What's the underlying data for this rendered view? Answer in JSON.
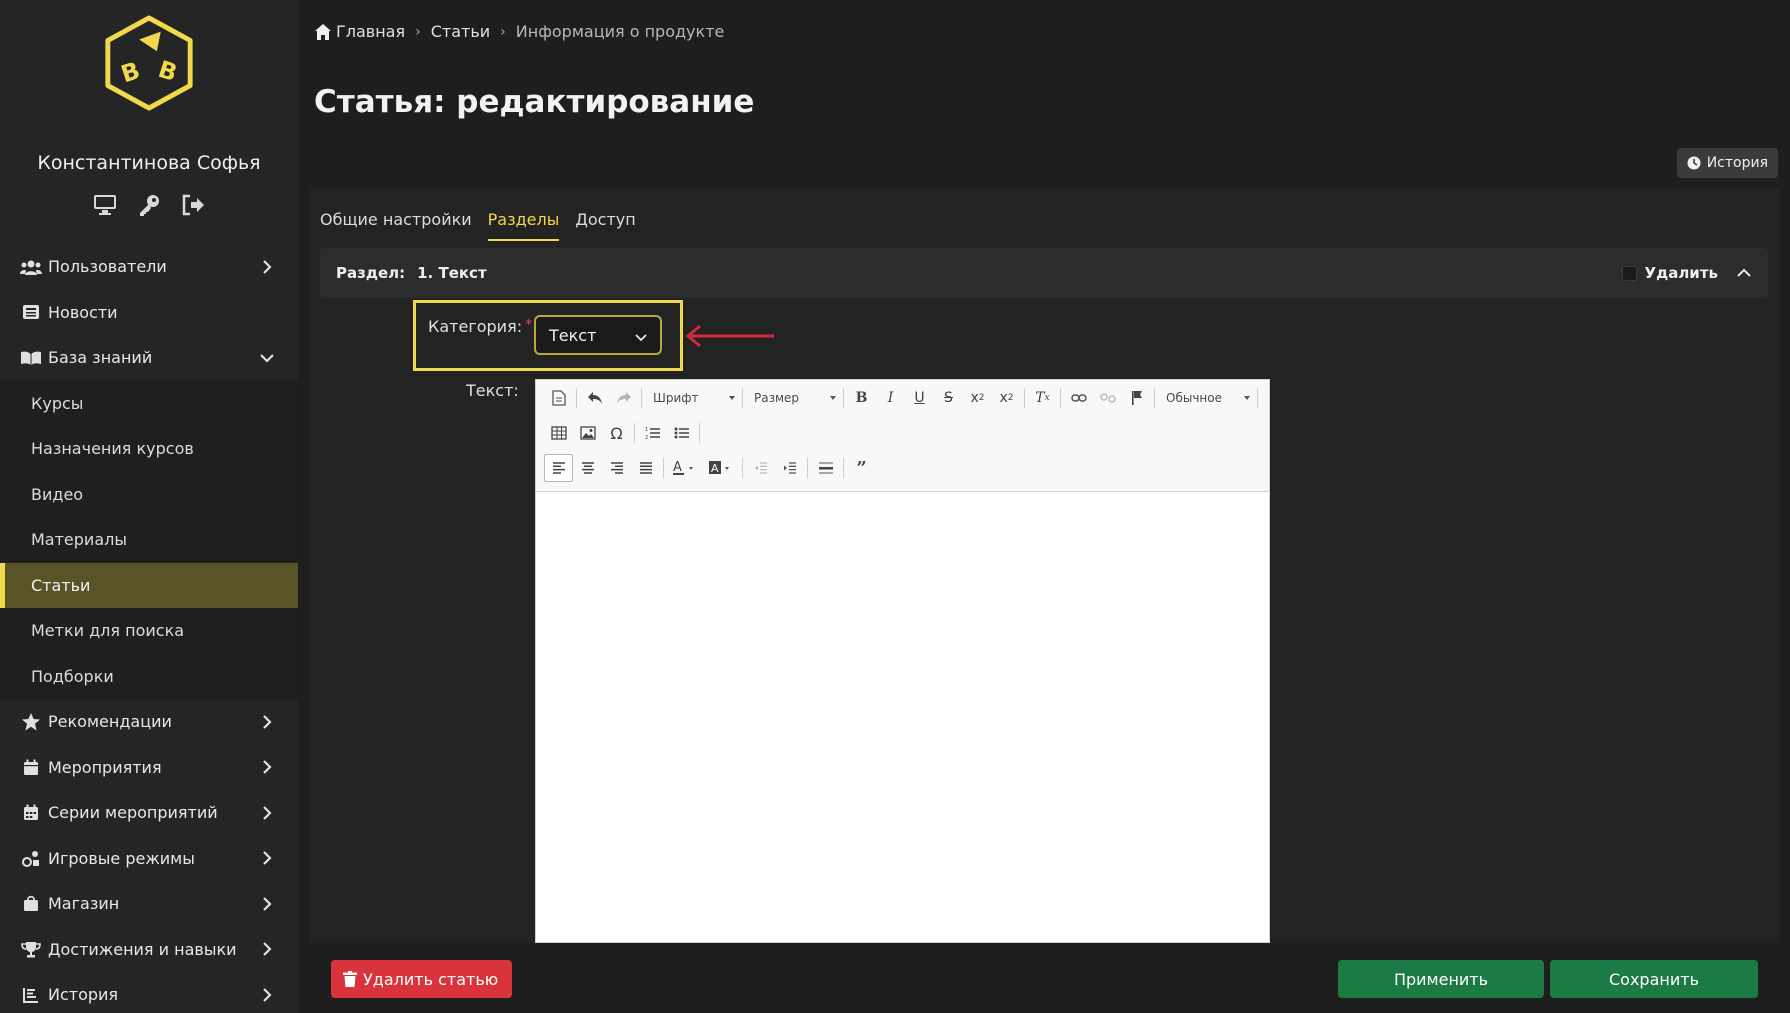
{
  "user": {
    "name": "Константинова Софья"
  },
  "nav": {
    "users": "Пользователи",
    "news": "Новости",
    "knowledge_base": "База знаний",
    "sub": [
      "Курсы",
      "Назначения курсов",
      "Видео",
      "Материалы",
      "Статьи",
      "Метки для поиска",
      "Подборки"
    ],
    "recommendations": "Рекомендации",
    "events": "Мероприятия",
    "event_series": "Серии мероприятий",
    "game_modes": "Игровые режимы",
    "shop": "Магазин",
    "achievements": "Достижения и навыки",
    "history": "История"
  },
  "breadcrumb": {
    "home": "Главная",
    "articles": "Статьи",
    "current": "Информация о продукте"
  },
  "page": {
    "title": "Статья: редактирование",
    "history_btn": "История"
  },
  "tabs": {
    "general": "Общие настройки",
    "sections": "Разделы",
    "access": "Доступ"
  },
  "section": {
    "label": "Раздел:",
    "title": "1. Текст",
    "delete_label": "Удалить"
  },
  "form": {
    "category_label": "Категория:",
    "required_mark": "*",
    "category_value": "Текст",
    "text_label": "Текст:"
  },
  "editor": {
    "font": "Шрифт",
    "size": "Размер",
    "format": "Обычное"
  },
  "actions": {
    "delete_article": "Удалить статью",
    "apply": "Применить",
    "save": "Сохранить"
  },
  "colors": {
    "accent": "#f1d94b",
    "green": "#1c7a45",
    "danger": "#d9343c",
    "arrow": "#d9253e"
  }
}
